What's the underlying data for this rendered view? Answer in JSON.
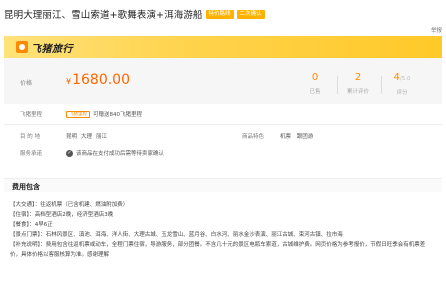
{
  "product": {
    "title": "昆明大理丽江、雪山索道+歌舞表演+洱海游船",
    "tags": [
      "特价路线",
      "二次确认"
    ],
    "report_label": "举报"
  },
  "brand": {
    "name": "飞猪旅行",
    "logo_icon": "fliggy-logo-icon"
  },
  "price": {
    "label": "价格",
    "currency": "¥",
    "amount": "1680.00"
  },
  "stats": [
    {
      "value": "0",
      "label": "已售"
    },
    {
      "value": "2",
      "label": "累计评价"
    },
    {
      "value": "4",
      "suffix": "/5.0",
      "label": "评分"
    }
  ],
  "mileage": {
    "label": "飞猪里程",
    "badge": "飞猪里程",
    "text": "可赠送840飞猪里程"
  },
  "destination": {
    "label": "目 的 地",
    "items": [
      "昆明",
      "大理",
      "丽江"
    ]
  },
  "features": {
    "label": "商品特色",
    "items": [
      "机票",
      "跟团游"
    ]
  },
  "service": {
    "label": "服务承诺",
    "text": "该商品在支付成功后需等待卖家确认"
  },
  "fee_section": {
    "title": "费用包含",
    "lines": [
      "【大交通】：往返机票（已含机建、燃油附加费）",
      "【住宿】：高档型酒店2晚，经济型酒店3晚",
      "【餐食】：4早6正",
      "【景点门票】：石林风景区、滇池、洱海、洋人街、大理古城、玉龙雪山、蓝月谷、白水河、丽水金沙表演、丽江古城、束河古镇、拉市海",
      "【补充说明】：费用包含往返机票或动车，全程门票住宿，导游服务，部分团餐。不含几十元的景区电瓶车索道，古城维护费。网页价格为参考报价，节假日旺季会有机票差价，具体价格以客服核算为准。感谢理解"
    ]
  }
}
